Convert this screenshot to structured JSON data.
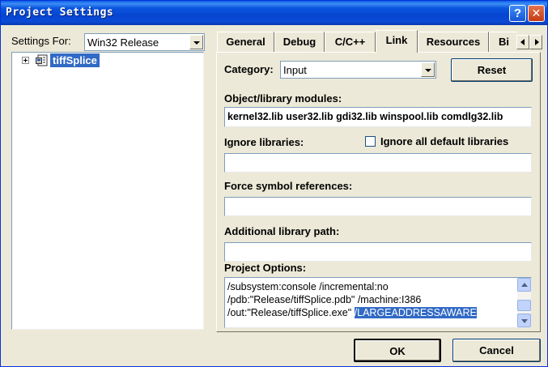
{
  "window": {
    "title": "Project Settings",
    "help_label": "?",
    "close_label": "✕",
    "accent": "#0a55df"
  },
  "settings_for": {
    "label": "Settings For:",
    "underline_char": "S",
    "value": "Win32 Release"
  },
  "tree": {
    "items": [
      {
        "label": "tiffSplice",
        "icon": "project-icon",
        "expander": "+"
      }
    ]
  },
  "tabs": [
    {
      "label": "General"
    },
    {
      "label": "Debug"
    },
    {
      "label": "C/C++"
    },
    {
      "label": "Link",
      "active": true
    },
    {
      "label": "Resources"
    },
    {
      "label": "Bi"
    }
  ],
  "link": {
    "category_label": "Category:",
    "category_value": "Input",
    "reset_label": "Reset",
    "object_modules_label": "Object/library modules:",
    "object_modules_value": "kernel32.lib user32.lib gdi32.lib winspool.lib comdlg32.lib",
    "ignore_libraries_label": "Ignore libraries:",
    "ignore_libraries_value": "",
    "ignore_all_label": "Ignore all default libraries",
    "ignore_all_checked": false,
    "force_symbols_label": "Force symbol references:",
    "force_symbols_value": "",
    "additional_path_label": "Additional library path:",
    "additional_path_value": "",
    "project_options_label": "Project Options:",
    "project_options_lines": [
      "/subsystem:console /incremental:no",
      "/pdb:\"Release/tiffSplice.pdb\" /machine:I386",
      "/out:\"Release/tiffSplice.exe\" "
    ],
    "project_options_selected": "/LARGEADDRESSAWARE"
  },
  "footer": {
    "ok_label": "OK",
    "cancel_label": "Cancel"
  }
}
